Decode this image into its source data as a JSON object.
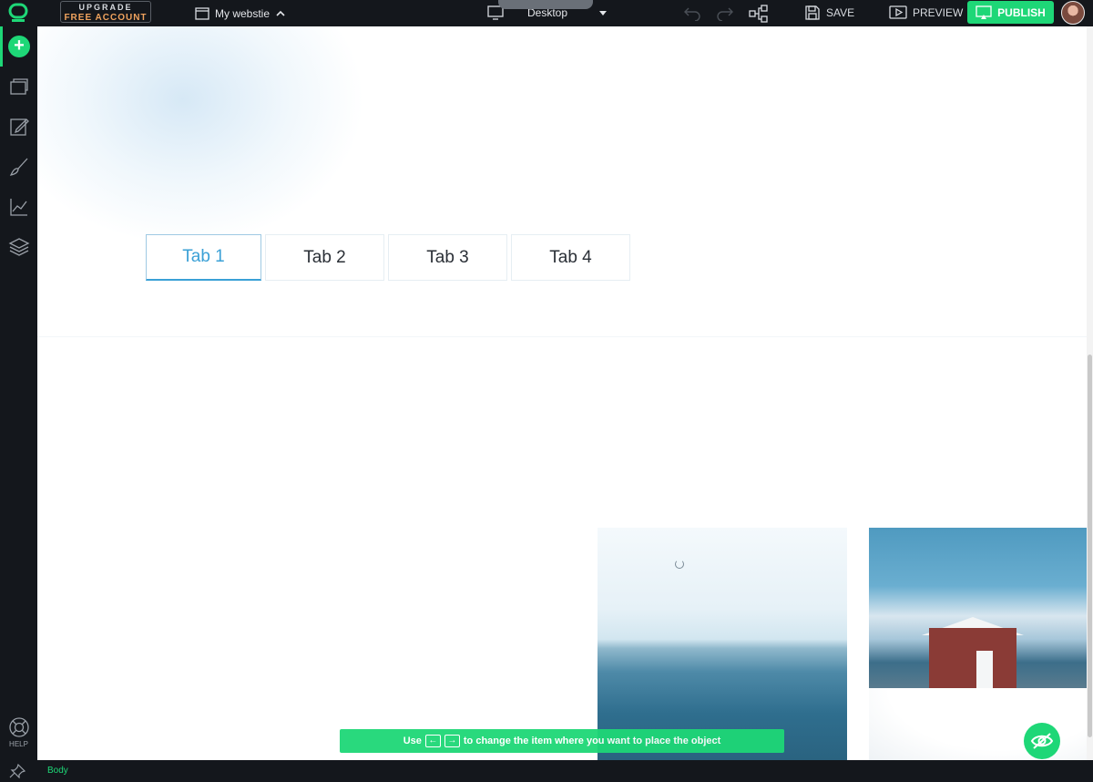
{
  "topbar": {
    "upgrade_line1": "UPGRADE",
    "upgrade_line2": "FREE ACCOUNT",
    "site_name": "My webstie",
    "device": "Desktop",
    "save_label": "SAVE",
    "preview_label": "PREVIEW",
    "publish_label": "PUBLISH"
  },
  "sidebar": {
    "help_label": "HELP"
  },
  "bottombar": {
    "breadcrumb": "Body"
  },
  "canvas": {
    "tabs": [
      {
        "label": "Tab 1"
      },
      {
        "label": "Tab 2"
      },
      {
        "label": "Tab 3"
      },
      {
        "label": "Tab 4"
      }
    ],
    "hint_prefix": "Use",
    "hint_key_left": "←",
    "hint_key_right": "→",
    "hint_text": "to change the item where you want to place the object"
  },
  "colors": {
    "accent": "#1ed777",
    "tab_active": "#3aa0d6",
    "upgrade_text": "#f0a35e"
  }
}
